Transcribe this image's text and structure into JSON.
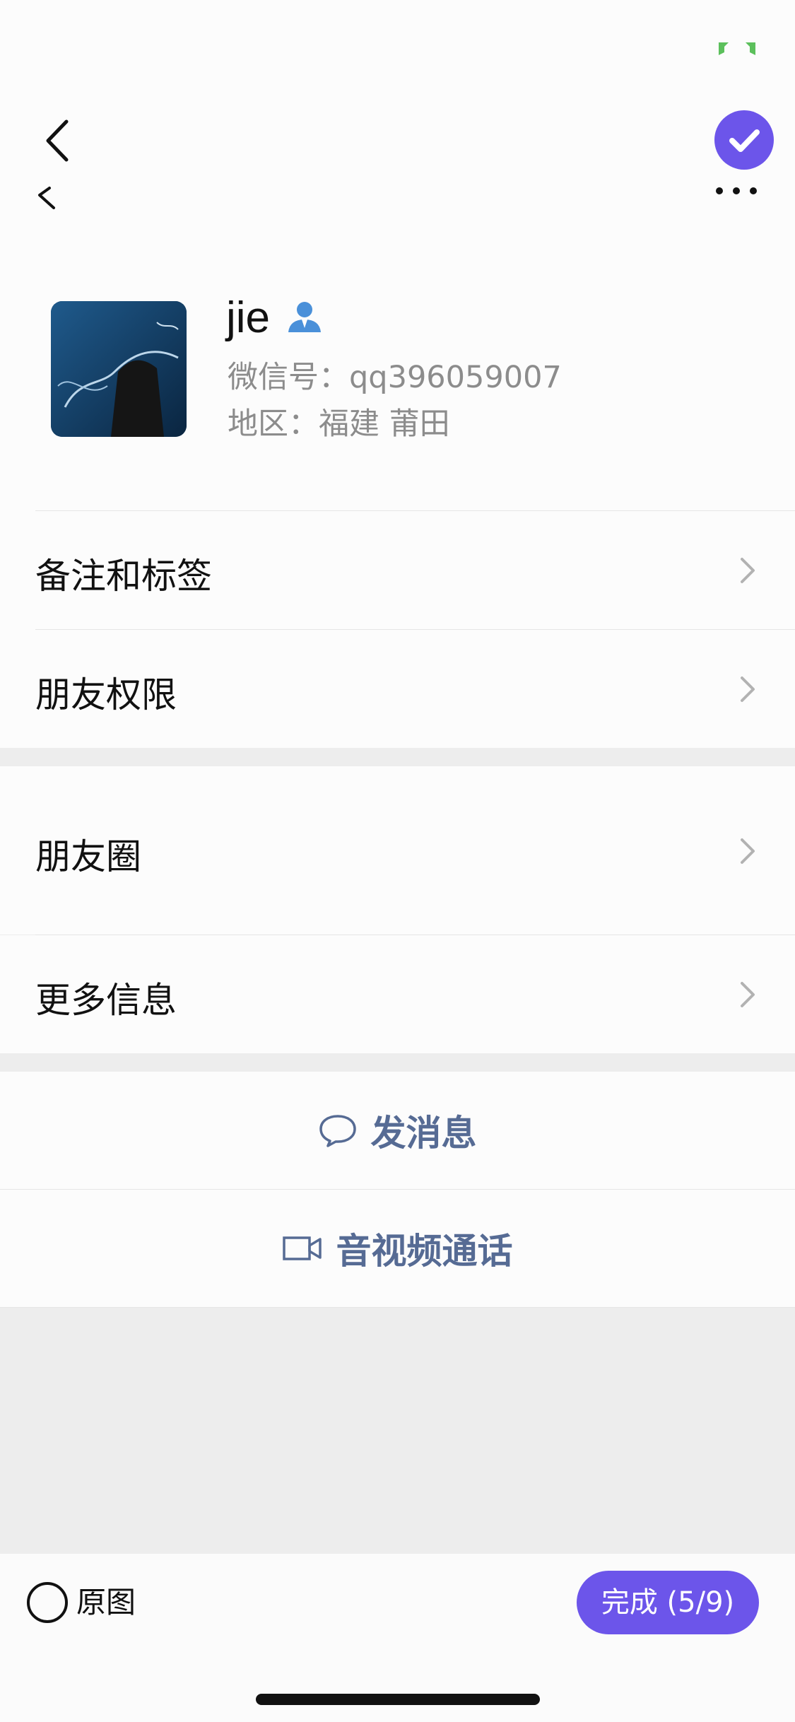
{
  "profile": {
    "name": "jie",
    "wechat_id": "微信号：qq396059007",
    "region": "地区：福建 莆田"
  },
  "menu": {
    "remarks_tags": "备注和标签",
    "friend_permissions": "朋友权限",
    "moments": "朋友圈",
    "more_info": "更多信息"
  },
  "actions": {
    "send_message": "发消息",
    "video_call": "音视频通话"
  },
  "bottom": {
    "original_label": "原图",
    "done_label": "完成 (5/9)"
  },
  "colors": {
    "accent": "#6c55ea",
    "link": "#566b94",
    "badge": "#4a90d9"
  },
  "icons": {
    "back": "chevron-left-icon",
    "select": "check-circle-icon",
    "more": "more-dots-icon",
    "badge": "contact-person-icon",
    "message": "chat-bubble-icon",
    "video": "video-camera-icon"
  }
}
